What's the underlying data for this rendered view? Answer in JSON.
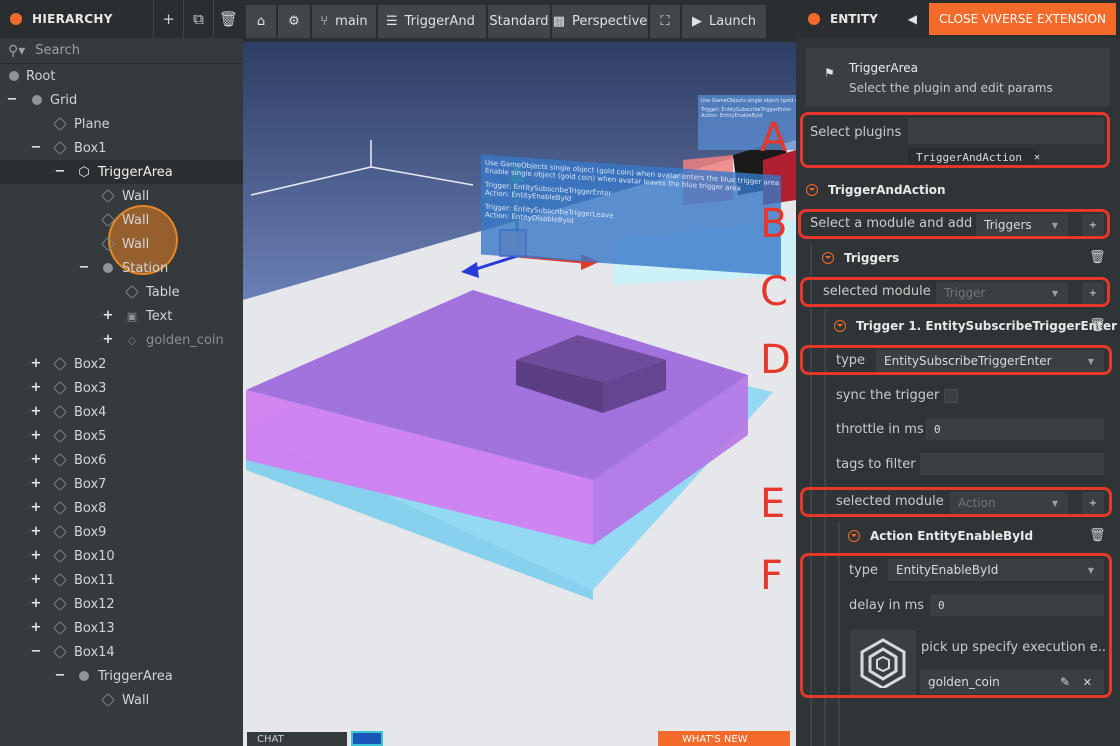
{
  "hierarchy": {
    "title": "HIERARCHY",
    "search_placeholder": "Search",
    "tree": [
      {
        "label": "Root"
      },
      {
        "label": "Grid"
      },
      {
        "label": "Plane"
      },
      {
        "label": "Box1"
      },
      {
        "label": "TriggerArea"
      },
      {
        "label": "Wall"
      },
      {
        "label": "Wall"
      },
      {
        "label": "Wall"
      },
      {
        "label": "Station"
      },
      {
        "label": "Table"
      },
      {
        "label": "Text"
      },
      {
        "label": "golden_coin"
      },
      {
        "label": "Box2"
      },
      {
        "label": "Box3"
      },
      {
        "label": "Box4"
      },
      {
        "label": "Box5"
      },
      {
        "label": "Box6"
      },
      {
        "label": "Box7"
      },
      {
        "label": "Box8"
      },
      {
        "label": "Box9"
      },
      {
        "label": "Box10"
      },
      {
        "label": "Box11"
      },
      {
        "label": "Box12"
      },
      {
        "label": "Box13"
      },
      {
        "label": "Box14"
      },
      {
        "label": "TriggerArea"
      },
      {
        "label": "Wall"
      }
    ]
  },
  "toolbar": {
    "branch": "main",
    "scene_name": "TriggerAnd",
    "mode": "Standard",
    "camera": "Perspective",
    "launch": "Launch"
  },
  "viewport": {
    "chat_label": "CHAT",
    "whats_new": "WHAT'S NEW",
    "label_panel_lines": [
      "Use GameObjects single object (gold coin) when avatar enters the blue trigger area",
      "Enable single object (gold coin) when avatar leaves the blue trigger area",
      "Trigger: EntitySubscribeTriggerEnter",
      "Action: EntityEnableById",
      "Trigger: EntitySubscribeTriggerLeave",
      "Action: EntityDisableById"
    ]
  },
  "entity": {
    "title": "ENTITY",
    "close_label": "CLOSE VIVERSE EXTENSION",
    "entity_name": "TriggerArea",
    "entity_hint": "Select the plugin and edit params",
    "select_plugins_label": "Select plugins",
    "plugin_chip": "TriggerAndAction",
    "plugin_section": "TriggerAndAction",
    "module_add_label": "Select a module and add",
    "module_add_value": "Triggers",
    "triggers_section": "Triggers",
    "selected_module_label": "selected module",
    "selected_module_trigger": "Trigger",
    "trigger1_title": "Trigger 1. EntitySubscribeTriggerEnter",
    "type_label": "type",
    "type_value": "EntitySubscribeTriggerEnter",
    "sync_label": "sync the trigger",
    "throttle_label": "throttle in ms",
    "throttle_value": "0",
    "tags_label": "tags to filter",
    "selected_module_label2": "selected module",
    "selected_module_action": "Action",
    "action_title": "Action EntityEnableById",
    "action_type_label": "type",
    "action_type_value": "EntityEnableById",
    "delay_label": "delay in ms",
    "delay_value": "0",
    "execution_label": "pick up specify execution e...",
    "entity_ref": "golden_coin"
  },
  "annotations": [
    "A",
    "B",
    "C",
    "D",
    "E",
    "F"
  ],
  "colors": {
    "accent": "#f36a2a",
    "highlight_box": "#e5382b",
    "panel_bg": "#2f3436",
    "field_bg": "#393f42"
  }
}
